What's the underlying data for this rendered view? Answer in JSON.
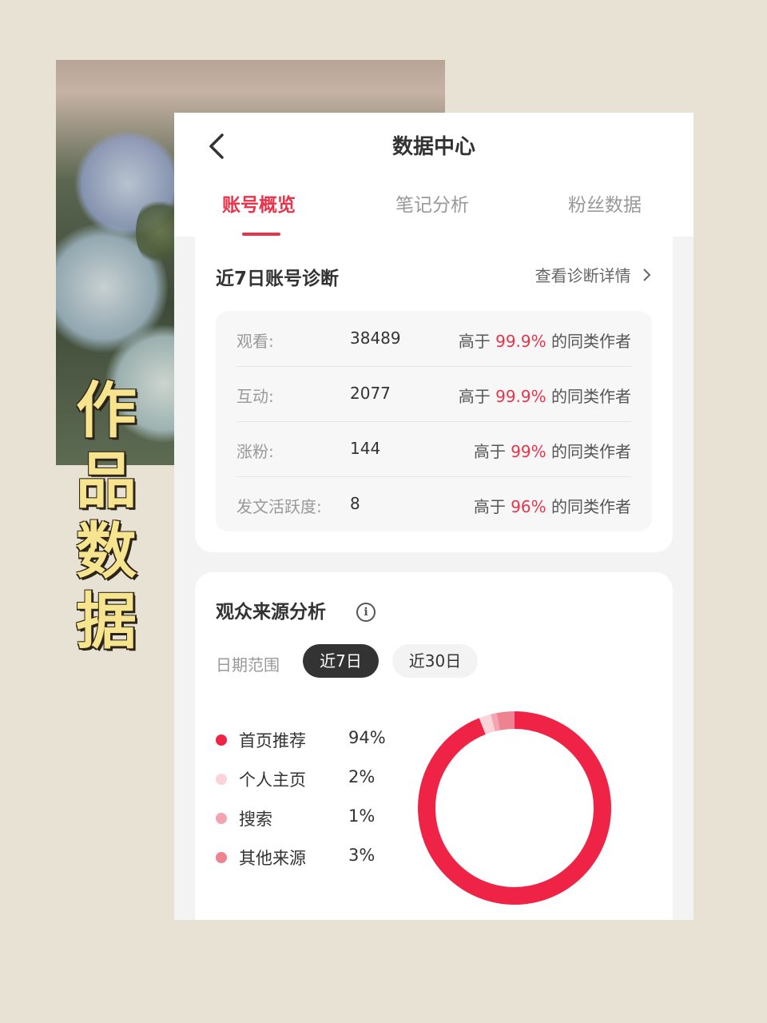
{
  "cover": {
    "title_chars": [
      "作",
      "品",
      "数",
      "据"
    ]
  },
  "header": {
    "title": "数据中心",
    "back_icon": "chevron-left-icon"
  },
  "tabs": [
    {
      "label": "账号概览",
      "active": true
    },
    {
      "label": "笔记分析",
      "active": false
    },
    {
      "label": "粉丝数据",
      "active": false
    }
  ],
  "diagnosis": {
    "title": "近7日账号诊断",
    "detail_link": "查看诊断详情",
    "rows": [
      {
        "label": "观看:",
        "value": "38489",
        "prefix": "高于",
        "pct": "99.9%",
        "suffix": "的同类作者"
      },
      {
        "label": "互动:",
        "value": "2077",
        "prefix": "高于",
        "pct": "99.9%",
        "suffix": "的同类作者"
      },
      {
        "label": "涨粉:",
        "value": "144",
        "prefix": "高于",
        "pct": "99%",
        "suffix": "的同类作者"
      },
      {
        "label": "发文活跃度:",
        "value": "8",
        "prefix": "高于",
        "pct": "96%",
        "suffix": "的同类作者"
      }
    ]
  },
  "source": {
    "title": "观众来源分析",
    "info_icon": "info-icon",
    "date_label": "日期范围",
    "range_options": [
      {
        "label": "近7日",
        "active": true
      },
      {
        "label": "近30日",
        "active": false
      }
    ]
  },
  "chart_data": {
    "type": "pie",
    "donut": true,
    "categories": [
      "首页推荐",
      "个人主页",
      "搜索",
      "其他来源"
    ],
    "values": [
      94,
      2,
      1,
      3
    ],
    "labels": [
      "94%",
      "2%",
      "1%",
      "3%"
    ],
    "colors": [
      "#ef2346",
      "#fbd4d9",
      "#f4a3b0",
      "#ef8291"
    ],
    "title": ""
  },
  "colors": {
    "accent": "#e8344a",
    "pill_active_bg": "#333333"
  }
}
